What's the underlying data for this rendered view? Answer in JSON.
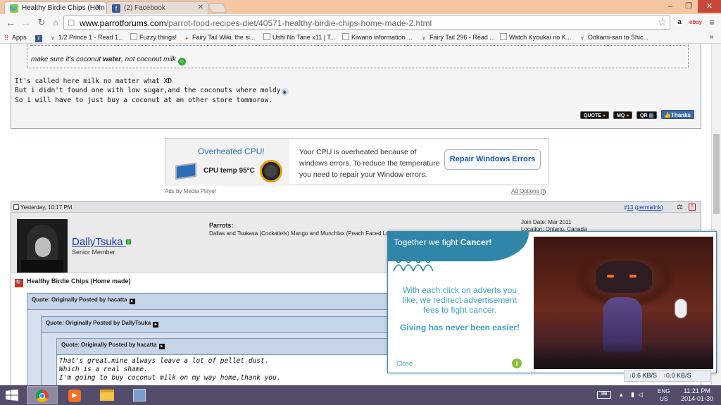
{
  "browser": {
    "tabs": [
      {
        "title": "Healthy Birdie Chips (Hom",
        "icon": "parrot-favicon"
      },
      {
        "title": "(2) Facebook",
        "icon": "facebook-favicon"
      }
    ],
    "url_host": "www.parrotforums.com",
    "url_path": "/parrot-food-recipes-diet/40571-healthy-birdie-chips-home-made-2.html",
    "extensions": [
      "amazon-icon",
      "ebay-icon"
    ],
    "bookmarks": [
      {
        "label": "Apps",
        "icon": "apps-grid-icon"
      },
      {
        "label": "",
        "icon": "facebook-icon"
      },
      {
        "label": "1/2 Prince 1 - Read 1...",
        "icon": "y-site-icon"
      },
      {
        "label": "Fuzzy things!",
        "icon": "page-icon"
      },
      {
        "label": "Fairy Tail Wiki, the si...",
        "icon": "fairytail-icon"
      },
      {
        "label": "Ushi No Tane x11 | T...",
        "icon": "page-icon"
      },
      {
        "label": "Kiwano information ...",
        "icon": "page-icon"
      },
      {
        "label": "Fairy Tail 296 - Read ...",
        "icon": "y-site-icon"
      },
      {
        "label": "Watch Kyoukai no K...",
        "icon": "page-icon"
      },
      {
        "label": "Ookami-san to Shic...",
        "icon": "y-site-icon"
      }
    ]
  },
  "post1": {
    "quote_text_pre": "make sure it's coconut ",
    "quote_text_bold": "water",
    "quote_text_post": ", not coconut milk",
    "lines": [
      "It's called here milk no matter what XD",
      "But i didn't found one with low sugar,and the coconuts where moldy",
      "So i will have to just buy a coconut at an other store tommorow."
    ],
    "buttons": {
      "quote": "QUOTE",
      "mq": "MQ",
      "qr": "QR",
      "thanks": "Thanks"
    }
  },
  "ad": {
    "title": "Overheated CPU!",
    "cpu": "CPU temp 95°C",
    "text": "Your CPU is overheated because of windows errors. To reduce the temperature you need to repair your Window errors.",
    "button": "Repair Windows Errors",
    "by": "Ads by Media Player",
    "options": "Ad Options"
  },
  "post2": {
    "date": "Yesterday, 10:17 PM",
    "post_number_prefix": "#",
    "post_number": "13",
    "permalink": "permalink",
    "parrots_label": "Parrots:",
    "parrots_value": "Dallas and Tsukasa (Cockatiels) Mango and Munchlax (Peach Faced Lovebirds)",
    "join_date": "Join Date: Mar 2011",
    "location": "Location: Ontario, Canada",
    "username": "DallyTsuka",
    "user_title": "Senior Member",
    "post_title": "Healthy Birdie Chips (Home made)",
    "quote1_header": "Quote: Originally Posted by hacatta",
    "quote2_header": "Quote: Originally Posted by DallyTsuka",
    "quote3_header": "Quote: Originally Posted by hacatta",
    "quote3_lines": [
      "That's great.mine always leave a lot of pellet dust.",
      "Which is a real shame.",
      "I'm going to buy coconut milk on my way home,thank you."
    ]
  },
  "popup": {
    "title_pre": "Together we fight ",
    "title_bold": "Cancer!",
    "body": "With each click on adverts you like, we redirect advertisement fees to fight cancer.",
    "cta": "Giving has never been easier!",
    "close": "Close",
    "info": "i",
    "colors": {
      "primary": "#2f86a8",
      "text": "#3fa3c6",
      "info": "#8cbf3f"
    }
  },
  "speed": {
    "down": "0.6 KB/S",
    "up": "0.0 KB/S"
  },
  "taskbar": {
    "lang": "ENG",
    "region": "US",
    "time": "11:21 PM",
    "date": "2014-01-30",
    "apps": [
      "chrome-icon",
      "media-player-icon",
      "file-explorer-icon",
      "tool-app-icon"
    ]
  }
}
